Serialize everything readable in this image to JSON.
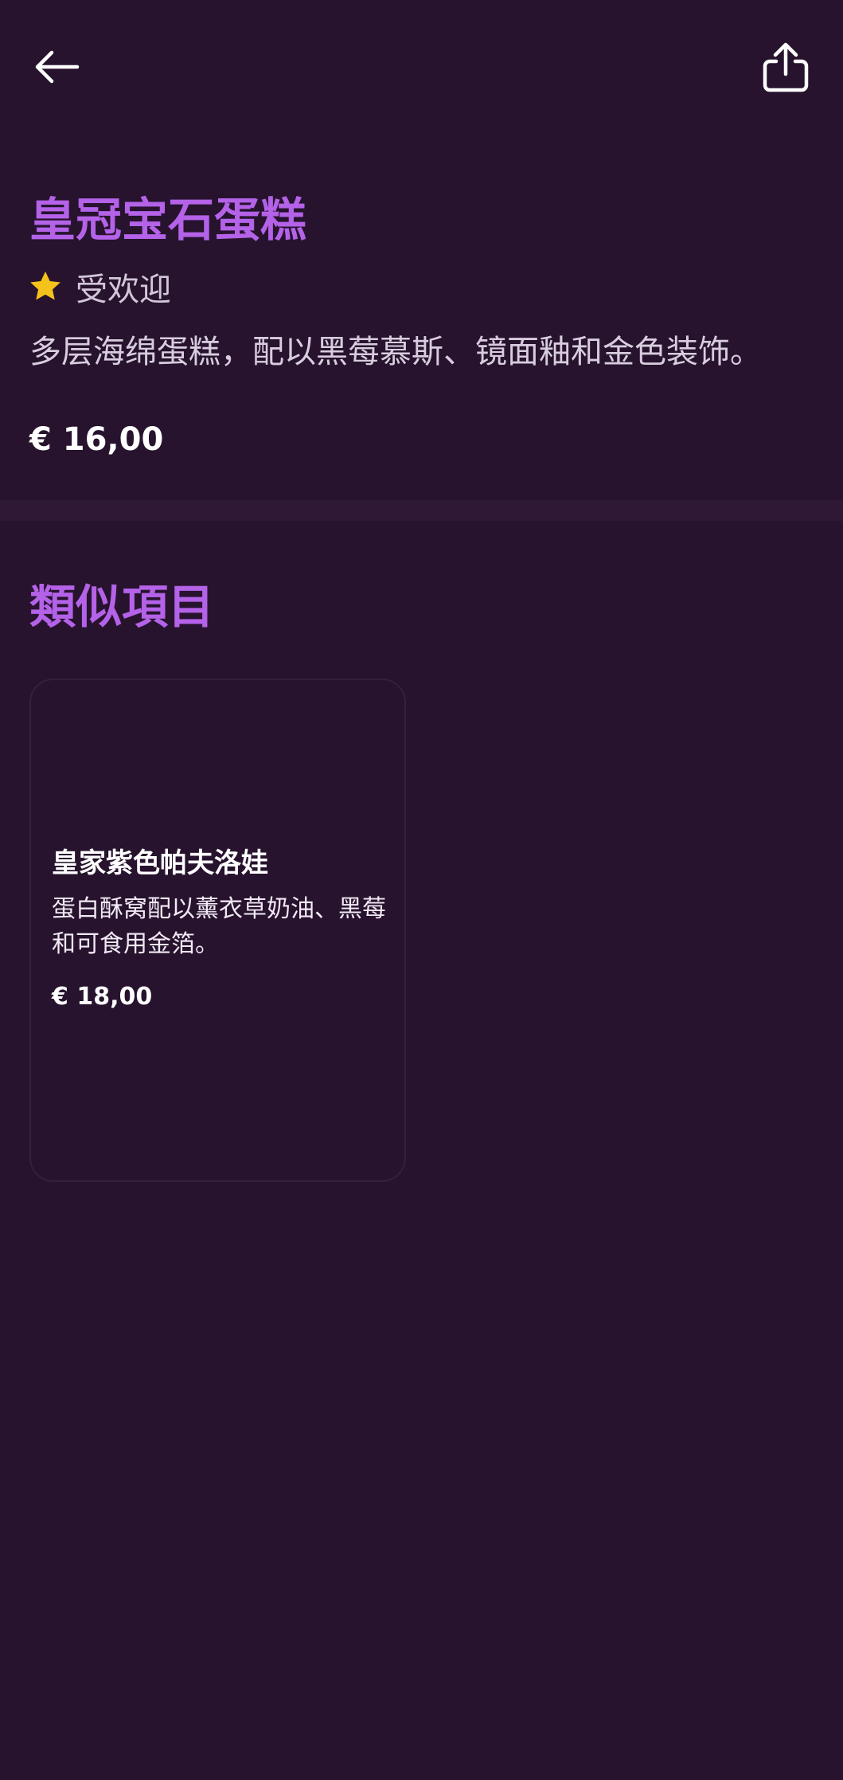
{
  "header": {
    "back_icon": "arrow-left-icon",
    "share_icon": "share-icon"
  },
  "product": {
    "title": "皇冠宝石蛋糕",
    "badge_icon": "star-icon",
    "badge_label": "受欢迎",
    "description": "多层海绵蛋糕，配以黑莓慕斯、镜面釉和金色装饰。",
    "price": "€ 16,00"
  },
  "similar": {
    "title": "類似項目",
    "items": [
      {
        "title": "皇家紫色帕夫洛娃",
        "description": "蛋白酥窝配以薰衣草奶油、黑莓和可食用金箔。",
        "price": "€ 18,00"
      }
    ]
  },
  "colors": {
    "background": "#27132e",
    "accent": "#b462e8",
    "star": "#f5c21b"
  }
}
